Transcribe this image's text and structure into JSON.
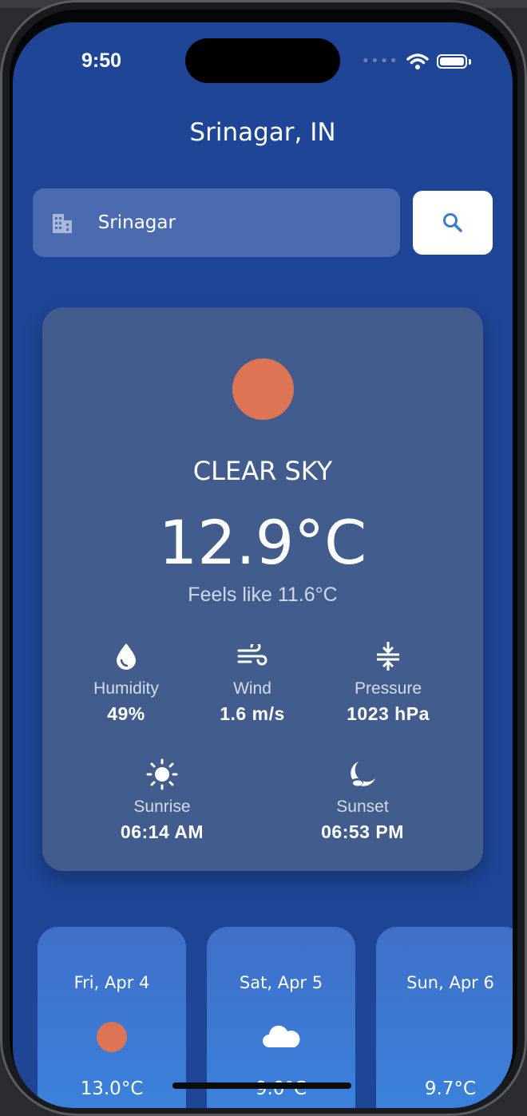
{
  "status_bar": {
    "time": "9:50"
  },
  "header": {
    "city_title": "Srinagar, IN"
  },
  "search": {
    "value": "Srinagar",
    "building_icon": "building-icon",
    "button_icon": "search-icon"
  },
  "current": {
    "icon": "sun",
    "icon_color": "#dd7453",
    "condition": "CLEAR SKY",
    "temperature": "12.9°C",
    "feels_like": "Feels like 11.6°C",
    "stats": {
      "humidity": {
        "label": "Humidity",
        "value": "49%",
        "icon": "drop-icon"
      },
      "wind": {
        "label": "Wind",
        "value": "1.6 m/s",
        "icon": "wind-icon"
      },
      "pressure": {
        "label": "Pressure",
        "value": "1023 hPa",
        "icon": "pressure-icon"
      },
      "sunrise": {
        "label": "Sunrise",
        "value": "06:14 AM",
        "icon": "sun-icon"
      },
      "sunset": {
        "label": "Sunset",
        "value": "06:53 PM",
        "icon": "moon-icon"
      }
    }
  },
  "forecast": [
    {
      "date": "Fri, Apr 4",
      "icon": "sun",
      "temp": "13.0°C"
    },
    {
      "date": "Sat, Apr 5",
      "icon": "cloud",
      "temp": "9.0°C"
    },
    {
      "date": "Sun, Apr 6",
      "icon": "none",
      "temp": "9.7°C"
    }
  ],
  "colors": {
    "background": "#1f4597",
    "card": "#435c8e",
    "accent_sun": "#dd7453",
    "search_button_icon": "#3a7bd5"
  }
}
